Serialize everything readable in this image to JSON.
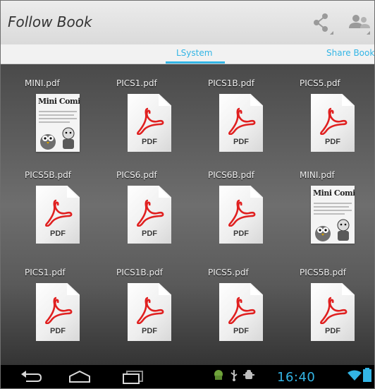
{
  "app": {
    "title": "Follow Book"
  },
  "action_bar": {
    "share_icon": "share-icon",
    "accounts_icon": "people-icon"
  },
  "tabs": [
    {
      "label": "LSystem",
      "selected": true
    },
    {
      "label": "Share Book",
      "selected": false
    }
  ],
  "files": [
    {
      "name": "MINI.pdf",
      "thumb": "mini"
    },
    {
      "name": "PICS1.pdf",
      "thumb": "pdf"
    },
    {
      "name": "PICS1B.pdf",
      "thumb": "pdf"
    },
    {
      "name": "PICS5.pdf",
      "thumb": "pdf"
    },
    {
      "name": "PICS5B.pdf",
      "thumb": "pdf"
    },
    {
      "name": "PICS6.pdf",
      "thumb": "pdf"
    },
    {
      "name": "PICS6B.pdf",
      "thumb": "pdf"
    },
    {
      "name": "MINI.pdf",
      "thumb": "mini"
    },
    {
      "name": "PICS1.pdf",
      "thumb": "pdf"
    },
    {
      "name": "PICS1B.pdf",
      "thumb": "pdf"
    },
    {
      "name": "PICS5.pdf",
      "thumb": "pdf"
    },
    {
      "name": "PICS5B.pdf",
      "thumb": "pdf"
    }
  ],
  "pdf_icon_label": "PDF",
  "mini_thumb_title": "Mini Comics",
  "system_bar": {
    "time": "16:40",
    "buttons": [
      "back-icon",
      "home-icon",
      "recent-apps-icon"
    ],
    "status_icons": [
      "android-icon",
      "usb-icon",
      "debug-icon",
      "wifi-icon",
      "battery-icon"
    ]
  },
  "colors": {
    "accent": "#33b5e5",
    "pdf_red": "#e02020"
  }
}
